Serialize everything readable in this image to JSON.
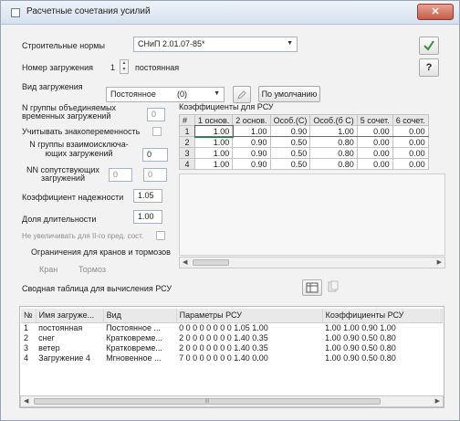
{
  "window": {
    "title": "Расчетные сочетания усилий",
    "close_label": "✕"
  },
  "form": {
    "norms_label": "Строительные нормы",
    "norms_value": "СНиП 2.01.07-85*",
    "load_num_label": "Номер загружения",
    "load_num_value": "1",
    "load_num_name": "постоянная",
    "load_type_label": "Вид загружения",
    "load_type_value": "Постоянное",
    "load_type_code": "(0)",
    "default_button": "По умолчанию",
    "n_group_temp_label": "N группы объединяемых временных загружений",
    "n_group_temp_value": "0",
    "sign_var_label": "Учитывать знакопеременность",
    "n_group_mutex_label": "N группы взаимоисключа- ющих загружений",
    "n_group_mutex_value": "0",
    "nn_accomp_label": "NN сопутствующих загружений",
    "nn_accomp_value1": "0",
    "nn_accomp_value2": "0",
    "reliability_label": "Коэффициент надежности",
    "reliability_value": "1.05",
    "duration_label": "Доля длительности",
    "duration_value": "1.00",
    "no_increase_label": "Не увеличивать для II-го пред. сост.",
    "crane_label": "Ограничения для кранов и тормозов",
    "crane_sub1": "Кран",
    "crane_sub2": "Тормоз"
  },
  "coef": {
    "title": "Коэффициенты для РСУ",
    "headers": [
      "#",
      "1 основ.",
      "2 основ.",
      "Особ.(С)",
      "Особ.(б С)",
      "5 сочет.",
      "6 сочет."
    ],
    "rows": [
      [
        "1",
        "1.00",
        "1.00",
        "0.90",
        "1.00",
        "0.00",
        "0.00"
      ],
      [
        "2",
        "1.00",
        "0.90",
        "0.50",
        "0.80",
        "0.00",
        "0.00"
      ],
      [
        "3",
        "1.00",
        "0.90",
        "0.50",
        "0.80",
        "0.00",
        "0.00"
      ],
      [
        "4",
        "1.00",
        "0.90",
        "0.50",
        "0.80",
        "0.00",
        "0.00"
      ]
    ]
  },
  "summary": {
    "title": "Сводная таблица для вычисления РСУ",
    "headers": [
      "№",
      "Имя загруже...",
      "Вид",
      "Параметры РСУ",
      "Коэффициенты РСУ"
    ],
    "rows": [
      [
        "1",
        "постоянная",
        "Постоянное ...",
        "0 0 0 0 0 0 0 0 1.05 1.00",
        "1.00 1.00 0.90 1.00"
      ],
      [
        "2",
        "снег",
        "Кратковреме...",
        "2 0 0 0 0 0 0 0 1.40 0.35",
        "1.00 0.90 0.50 0.80"
      ],
      [
        "3",
        "ветер",
        "Кратковреме...",
        "2 0 0 0 0 0 0 0 1.40 0.35",
        "1.00 0.90 0.50 0.80"
      ],
      [
        "4",
        "Загружение 4",
        "Мгновенное ...",
        "7 0 0 0 0 0 0 0 1.40 0.00",
        "1.00 0.90 0.50 0.80"
      ]
    ],
    "scroll_label": "III"
  },
  "colors": {
    "accent_selected": "#2e7d4f",
    "row_highlight": "#d73a3a",
    "close": "#c85b46"
  },
  "icons": [
    "window-icon",
    "close-icon",
    "check-icon",
    "help-icon",
    "pencil-icon",
    "table-icon",
    "copy-icon"
  ]
}
